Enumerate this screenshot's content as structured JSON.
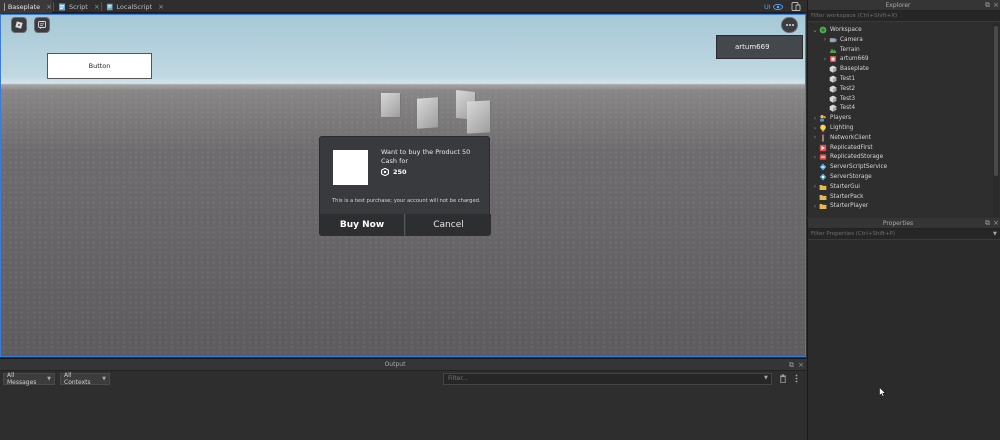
{
  "tabs": [
    {
      "label": "Baseplate",
      "active": true
    },
    {
      "label": "Script",
      "active": false
    },
    {
      "label": "LocalScript",
      "active": false
    }
  ],
  "tab_close_glyph": "×",
  "ui_toggle_label": "UI",
  "viewport": {
    "gui_button_label": "Button",
    "player_name": "artum669"
  },
  "purchase_dialog": {
    "title": "Want to buy the Product 50 Cash for",
    "price": "250",
    "disclaimer": "This is a test purchase; your account will not be charged.",
    "buy_label": "Buy Now",
    "cancel_label": "Cancel"
  },
  "output": {
    "title": "Output",
    "messages_filter": "All Messages",
    "contexts_filter": "All Contexts",
    "filter_placeholder": "Filter..."
  },
  "explorer": {
    "title": "Explorer",
    "filter_placeholder": "Filter workspace (Ctrl+Shift+X)",
    "items": [
      {
        "label": "Workspace",
        "depth": 0,
        "arrow": "v",
        "icon": "workspace-icon"
      },
      {
        "label": "Camera",
        "depth": 1,
        "arrow": ">",
        "icon": "camera-icon"
      },
      {
        "label": "Terrain",
        "depth": 1,
        "arrow": "",
        "icon": "terrain-icon"
      },
      {
        "label": "artum669",
        "depth": 1,
        "arrow": ">",
        "icon": "character-icon"
      },
      {
        "label": "Baseplate",
        "depth": 1,
        "arrow": "",
        "icon": "part-icon"
      },
      {
        "label": "Test1",
        "depth": 1,
        "arrow": "",
        "icon": "part-icon"
      },
      {
        "label": "Test2",
        "depth": 1,
        "arrow": "",
        "icon": "part-icon"
      },
      {
        "label": "Test3",
        "depth": 1,
        "arrow": "",
        "icon": "part-icon"
      },
      {
        "label": "Test4",
        "depth": 1,
        "arrow": "",
        "icon": "part-icon"
      },
      {
        "label": "Players",
        "depth": 0,
        "arrow": ">",
        "icon": "players-icon"
      },
      {
        "label": "Lighting",
        "depth": 0,
        "arrow": ">",
        "icon": "lighting-icon"
      },
      {
        "label": "NetworkClient",
        "depth": 0,
        "arrow": ">",
        "icon": "network-icon"
      },
      {
        "label": "ReplicatedFirst",
        "depth": 0,
        "arrow": "",
        "icon": "replicated-first-icon"
      },
      {
        "label": "ReplicatedStorage",
        "depth": 0,
        "arrow": ">",
        "icon": "replicated-storage-icon"
      },
      {
        "label": "ServerScriptService",
        "depth": 0,
        "arrow": "",
        "icon": "server-script-service-icon"
      },
      {
        "label": "ServerStorage",
        "depth": 0,
        "arrow": "",
        "icon": "server-storage-icon"
      },
      {
        "label": "StarterGui",
        "depth": 0,
        "arrow": ">",
        "icon": "folder-icon"
      },
      {
        "label": "StarterPack",
        "depth": 0,
        "arrow": "",
        "icon": "folder-icon"
      },
      {
        "label": "StarterPlayer",
        "depth": 0,
        "arrow": ">",
        "icon": "folder-icon"
      }
    ]
  },
  "properties": {
    "title": "Properties",
    "filter_placeholder": "Filter Properties (Ctrl+Shift+P)"
  },
  "colors": {
    "accent": "#3b7dd8",
    "panel_bg": "#2e2e2e",
    "dialog_bg": "#383a3d"
  }
}
